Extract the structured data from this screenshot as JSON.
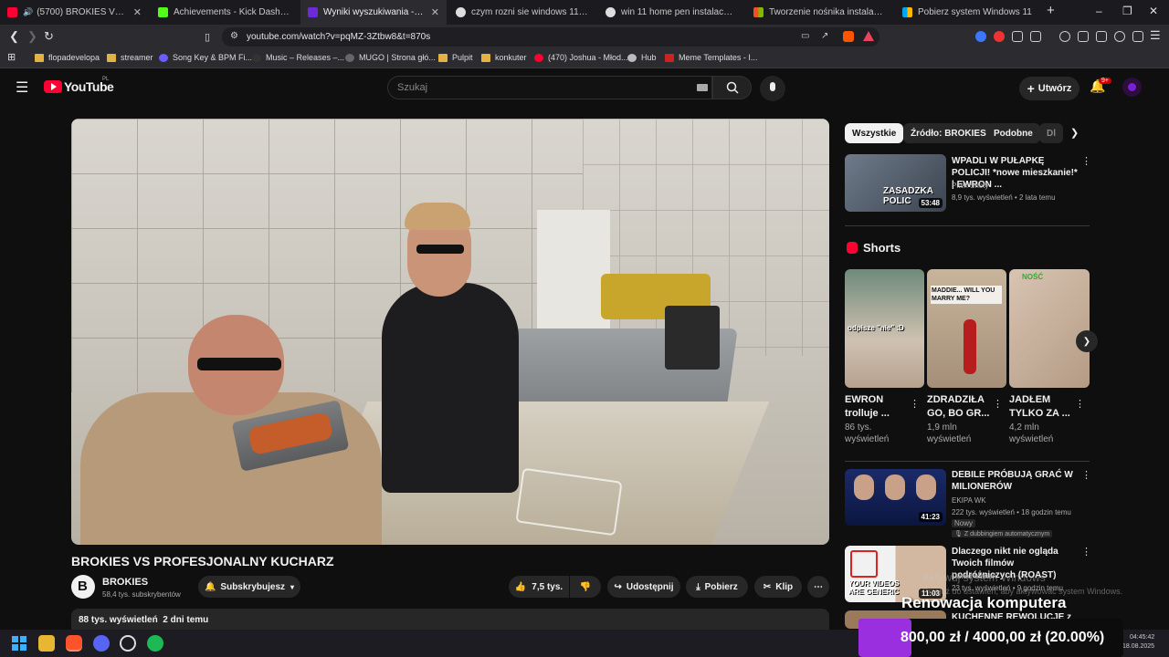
{
  "tabs": [
    {
      "title": "(5700) BROKIES VS PROFESJONALNY KUCHARZ",
      "color": "#ff0033",
      "active": false
    },
    {
      "title": "Achievements - Kick Dashboard",
      "color": "#53fc18",
      "active": false
    },
    {
      "title": "Wyniki wyszukiwania - x-kom",
      "color": "#6b2bd9",
      "active": true
    },
    {
      "title": "czym rozni sie windows 11 home od",
      "color": "#dddddd",
      "active": false
    },
    {
      "title": "win 11 home pen instalacyjny - Goo",
      "color": "#dddddd",
      "active": false
    },
    {
      "title": "Tworzenie nośnika instalacyjnego dla",
      "color": "#f2b600",
      "active": false
    },
    {
      "title": "Pobierz system Windows 11",
      "color": "#f2b600",
      "active": false
    }
  ],
  "address": {
    "url": "youtube.com/watch?v=pqMZ-3Ztbw8&t=870s"
  },
  "bookmarks": [
    {
      "label": "flopadevelopa",
      "color": "#e3b341"
    },
    {
      "label": "streamer",
      "color": "#e3b341"
    },
    {
      "label": "Song Key & BPM Fi...",
      "color": "#6a5cff"
    },
    {
      "label": "Music – Releases –...",
      "color": "#333333"
    },
    {
      "label": "MUGO | Strona głó...",
      "color": "#666666"
    },
    {
      "label": "Pulpit",
      "color": "#e3b341"
    },
    {
      "label": "konkuter",
      "color": "#e3b341"
    },
    {
      "label": "(470) Joshua - Młod...",
      "color": "#ff0033"
    },
    {
      "label": "Hub",
      "color": "#bbbbbb"
    },
    {
      "label": "Meme Templates - I...",
      "color": "#cc2222"
    }
  ],
  "youtube": {
    "logo": "YouTube",
    "region": "PL",
    "search_placeholder": "Szukaj",
    "create_label": "Utwórz",
    "notif_count": "9+"
  },
  "video": {
    "title": "BROKIES VS PROFESJONALNY KUCHARZ",
    "channel": "BROKIES",
    "subscribers": "58,4 tys. subskrybentów",
    "subscribe_label": "Subskrybujesz",
    "likes": "7,5 tys.",
    "share_label": "Udostępnij",
    "download_label": "Pobierz",
    "clip_label": "Klip",
    "views_date": "88 tys. wyświetleń  2 dni temu"
  },
  "chips": [
    "Wszystkie",
    "Źródło: BROKIES",
    "Podobne",
    "Dl"
  ],
  "recommended_top": {
    "title": "WPADLI W PUŁAPKĘ POLICJI! *nowe mieszkanie!* | EWRON ...",
    "channel": "Pitek Shoty",
    "meta": "8,9 tys. wyświetleń • 2 lata temu",
    "duration": "53:48",
    "thumb_text": "ZASADZKA POLIC"
  },
  "shorts": {
    "heading": "Shorts",
    "items": [
      {
        "title": "EWRON trolluje ...",
        "views": "86 tys. wyświetleń",
        "thumb_text": "odpisze \"nie\" :D"
      },
      {
        "title": "ZDRADZIŁA GO, BO GR...",
        "views": "1,9 mln wyświetleń",
        "thumb_text": "MADDIE... WILL YOU MARRY ME?"
      },
      {
        "title": "JADŁEM TYLKO ZA ...",
        "views": "4,2 mln wyświetleń",
        "thumb_text": "NOŚĆ"
      }
    ]
  },
  "recommended": [
    {
      "title": "DEBILE PRÓBUJĄ GRAĆ W MILIONERÓW",
      "channel": "EKIPA WK",
      "meta": "222 tys. wyświetleń • 18 godzin temu",
      "badge": "Nowy",
      "dub": "Z dubbingiem automatycznym",
      "duration": "41:23"
    },
    {
      "title": "Dlaczego nikt nie ogląda Twoich filmów podróżniczych (ROAST)",
      "channel": "Dawid Marian",
      "meta": "23 tys. wyświetleń • 9 godzin temu",
      "duration": "11:03",
      "thumb_text": "YOUR VIDEOS ARE GENERIC"
    },
    {
      "title": "KUCHENNE REWOLUCJE z MANDZIEM (Magda odpisuje...)"
    }
  ],
  "overlay": {
    "activate_title": "Aktywuj system Windows",
    "activate_sub": "Przejdź do ustawień, aby aktywować system Windows.",
    "goal_title": "Renowacja komputera",
    "goal_amount": "800,00 zł / 4000,00 zł (20.00%)",
    "goal_progress": 0.2
  },
  "clock": {
    "time": "04:45:42",
    "date": "18.08.2025"
  }
}
